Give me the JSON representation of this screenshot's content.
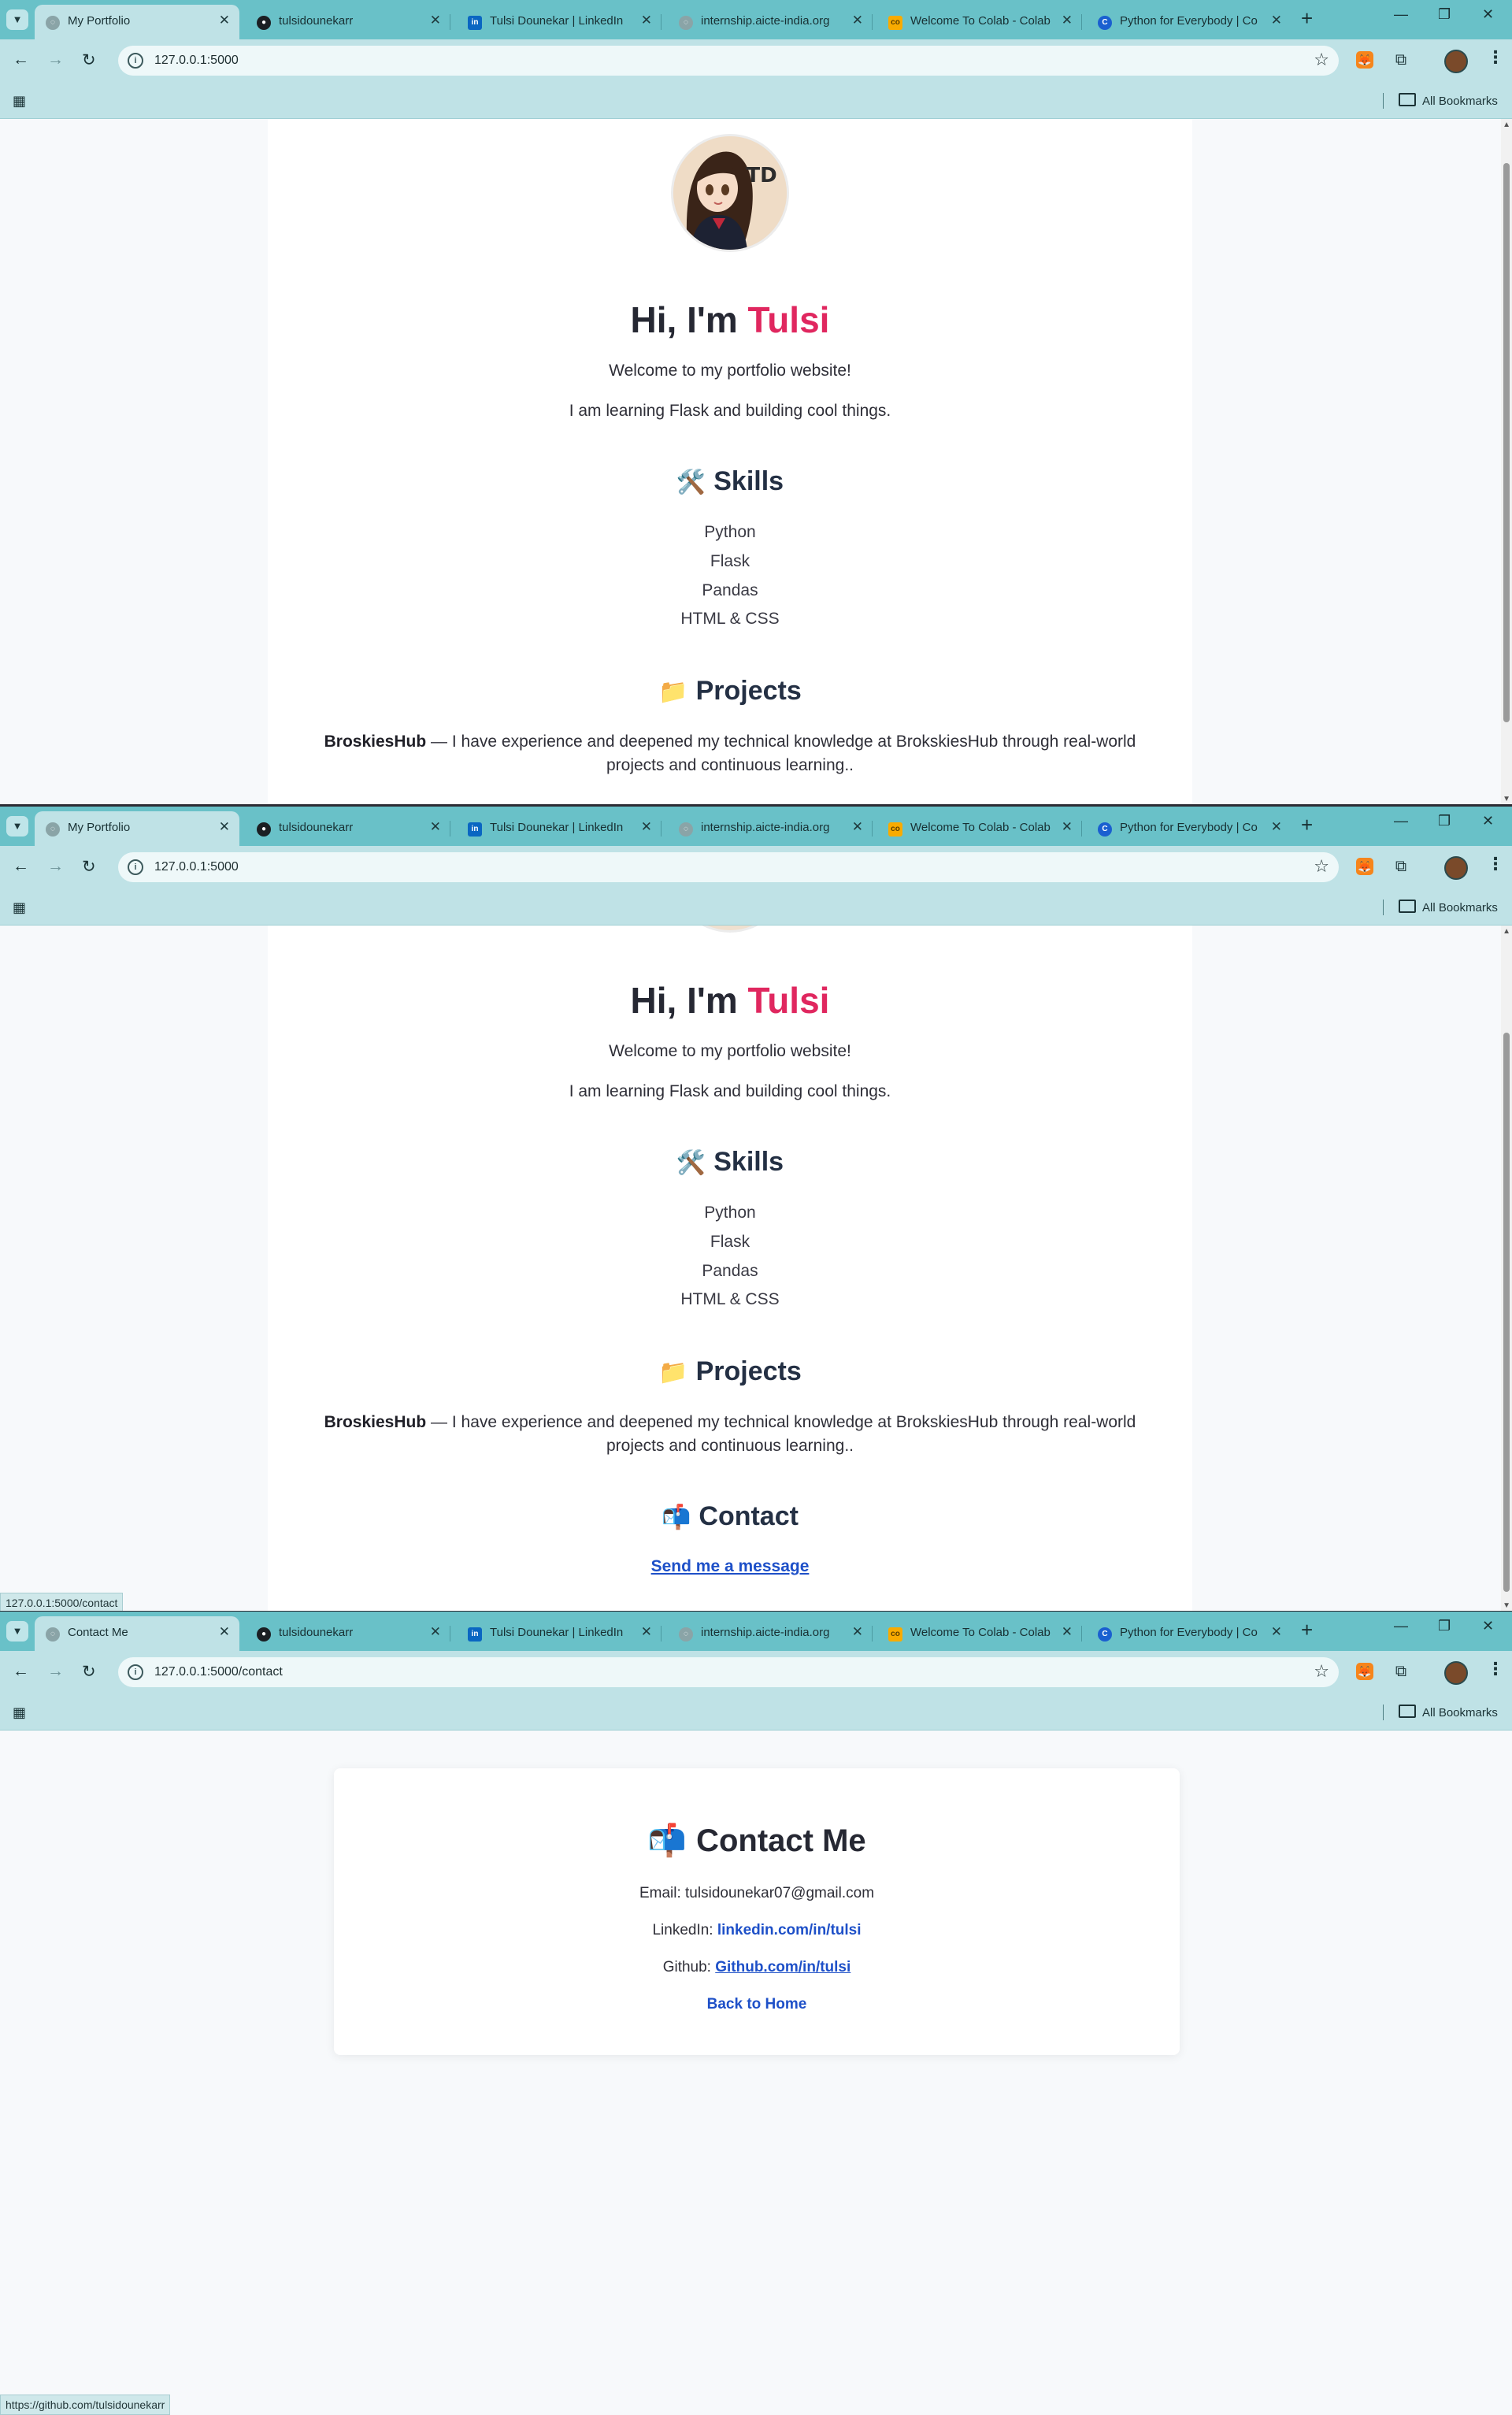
{
  "tabs": [
    {
      "title": "My Portfolio",
      "icon": "globe-icon"
    },
    {
      "title": "tulsidounekarr",
      "icon": "github-icon"
    },
    {
      "title": "Tulsi Dounekar | LinkedIn",
      "icon": "linkedin-icon"
    },
    {
      "title": "internship.aicte-india.org",
      "icon": "globe-icon"
    },
    {
      "title": "Welcome To Colab - Colab",
      "icon": "colab-icon"
    },
    {
      "title": "Python for Everybody | Co",
      "icon": "coursera-icon"
    }
  ],
  "contact_tab_title": "Contact Me",
  "bookmarks_label": "All Bookmarks",
  "urls": {
    "home": "127.0.0.1:5000",
    "contact": "127.0.0.1:5000/contact"
  },
  "profile": {
    "initials": "TD"
  },
  "home": {
    "greeting": "Hi, I'm",
    "name": "Tulsi",
    "welcome": "Welcome to my portfolio website!",
    "learning": "I am learning Flask and building cool things.",
    "skills_emoji": "🛠️",
    "skills_title": "Skills",
    "skills": [
      "Python",
      "Flask",
      "Pandas",
      "HTML & CSS"
    ],
    "projects_emoji": "📁",
    "projects_title": "Projects",
    "project_name": "BroskiesHub",
    "project_desc": "— I have experience and deepened my technical knowledge at BrokskiesHub through real-world projects and continuous learning..",
    "contact_emoji": "📬",
    "contact_title": "Contact",
    "contact_link": "Send me a message"
  },
  "status": {
    "hover_contact": "127.0.0.1:5000/contact",
    "hover_github": "https://github.com/tulsidounekarr"
  },
  "contact": {
    "emoji": "📬",
    "title": "Contact Me",
    "email_label": "Email:",
    "email": "tulsidounekar07@gmail.com",
    "linkedin_label": "LinkedIn:",
    "linkedin": "linkedin.com/in/tulsi",
    "github_label": "Github:",
    "github": "Github.com/in/tulsi",
    "back": "Back to Home"
  },
  "colors": {
    "accent": "#e0275f",
    "link": "#1e50c8",
    "chrome": "#69c1c8",
    "toolbar": "#bfe2e6"
  }
}
